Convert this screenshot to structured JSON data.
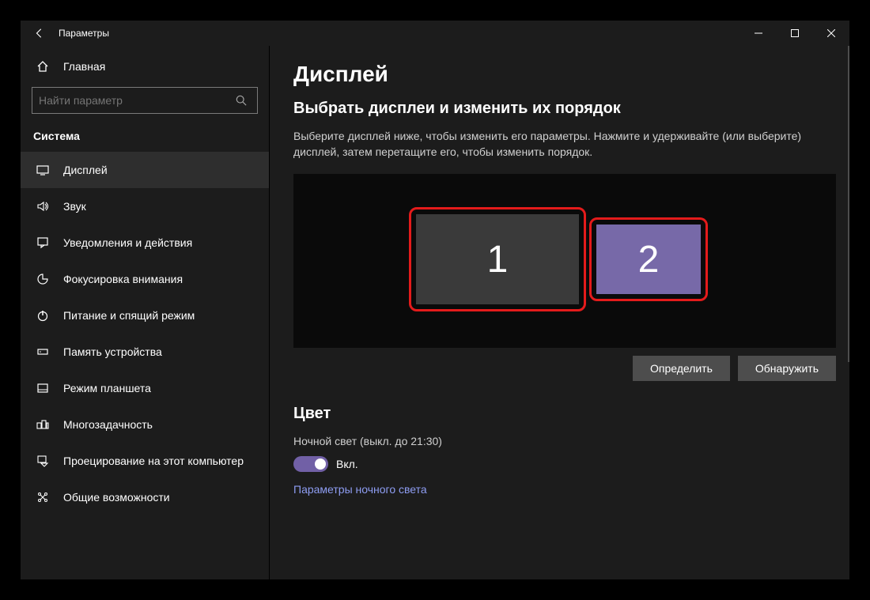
{
  "titlebar": {
    "title": "Параметры"
  },
  "sidebar": {
    "home": "Главная",
    "search_placeholder": "Найти параметр",
    "section": "Система",
    "items": [
      {
        "label": "Дисплей",
        "icon": "display"
      },
      {
        "label": "Звук",
        "icon": "sound"
      },
      {
        "label": "Уведомления и действия",
        "icon": "notifications"
      },
      {
        "label": "Фокусировка внимания",
        "icon": "focus"
      },
      {
        "label": "Питание и спящий режим",
        "icon": "power"
      },
      {
        "label": "Память устройства",
        "icon": "storage"
      },
      {
        "label": "Режим планшета",
        "icon": "tablet"
      },
      {
        "label": "Многозадачность",
        "icon": "multitask"
      },
      {
        "label": "Проецирование на этот компьютер",
        "icon": "project"
      },
      {
        "label": "Общие возможности",
        "icon": "shared"
      }
    ]
  },
  "main": {
    "page_title": "Дисплей",
    "arrange_heading": "Выбрать дисплеи и изменить их порядок",
    "arrange_body": "Выберите дисплей ниже, чтобы изменить его параметры. Нажмите и удерживайте (или выберите) дисплей, затем перетащите его, чтобы изменить порядок.",
    "monitor1": "1",
    "monitor2": "2",
    "identify_btn": "Определить",
    "detect_btn": "Обнаружить",
    "color_heading": "Цвет",
    "night_light_label": "Ночной свет (выкл. до 21:30)",
    "toggle_label": "Вкл.",
    "night_light_settings_link": "Параметры ночного света"
  }
}
